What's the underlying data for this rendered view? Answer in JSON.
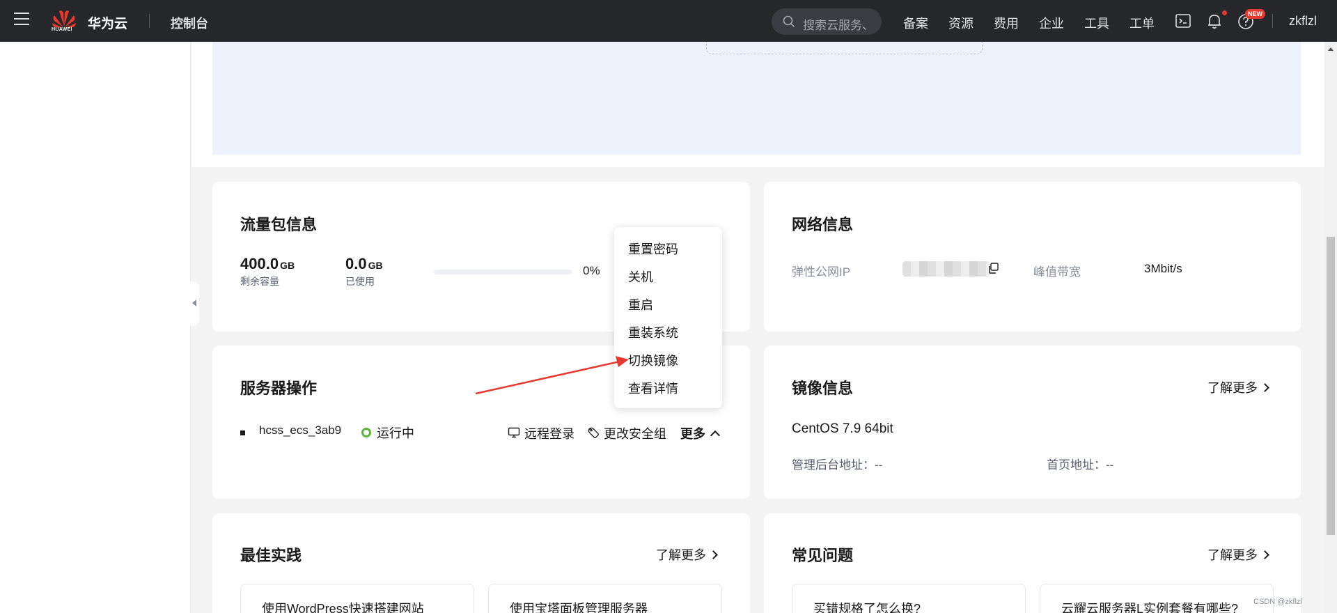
{
  "header": {
    "brand": "华为云",
    "logo_text": "HUAWEI",
    "console": "控制台",
    "search_placeholder": "搜索云服务、",
    "nav_links": [
      "备案",
      "资源",
      "费用",
      "企业",
      "工具",
      "工单"
    ],
    "new_badge": "NEW",
    "username": "zkflzl"
  },
  "traffic": {
    "title": "流量包信息",
    "remaining_value": "400.0",
    "remaining_unit": "GB",
    "remaining_label": "剩余容量",
    "used_value": "0.0",
    "used_unit": "GB",
    "used_label": "已使用",
    "percent": "0%",
    "progress_fraction": 0
  },
  "network": {
    "title": "网络信息",
    "ip_label": "弹性公网IP",
    "bandwidth_label": "峰值带宽",
    "bandwidth_value": "3Mbit/s"
  },
  "server": {
    "title": "服务器操作",
    "name": "hcss_ecs_3ab9",
    "status": "运行中",
    "remote_login": "远程登录",
    "change_security_group": "更改安全组",
    "more": "更多"
  },
  "dropdown": {
    "items": [
      "重置密码",
      "关机",
      "重启",
      "重装系统",
      "切换镜像",
      "查看详情"
    ]
  },
  "image": {
    "title": "镜像信息",
    "learn_more": "了解更多",
    "os": "CentOS 7.9 64bit",
    "admin_url_label": "管理后台地址：--",
    "home_url_label": "首页地址：--"
  },
  "best_practice": {
    "title": "最佳实践",
    "learn_more": "了解更多",
    "items": [
      "使用WordPress快速搭建网站",
      "使用宝塔面板管理服务器"
    ]
  },
  "faq": {
    "title": "常见问题",
    "learn_more": "了解更多",
    "items": [
      "买错规格了怎么换?",
      "云耀云服务器L实例套餐有哪些?"
    ]
  },
  "watermark": "CSDN @zkflzl",
  "colors": {
    "topbar": "#25272b",
    "status_green": "#5ab43a",
    "annotation_red": "#e8392e",
    "hero_bg": "#eef2fd"
  }
}
